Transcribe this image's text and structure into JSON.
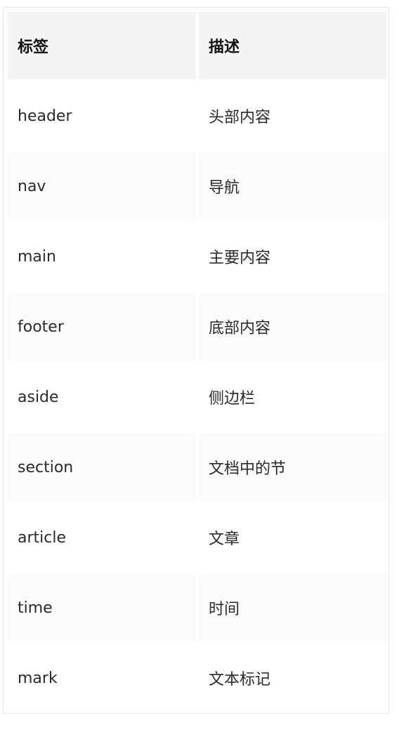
{
  "table": {
    "headers": [
      "标签",
      "描述"
    ],
    "rows": [
      [
        "header",
        "头部内容"
      ],
      [
        "nav",
        "导航"
      ],
      [
        "main",
        "主要内容"
      ],
      [
        "footer",
        "底部内容"
      ],
      [
        "aside",
        "侧边栏"
      ],
      [
        "section",
        "文档中的节"
      ],
      [
        "article",
        "文章"
      ],
      [
        "time",
        "时间"
      ],
      [
        "mark",
        "文本标记"
      ]
    ]
  }
}
